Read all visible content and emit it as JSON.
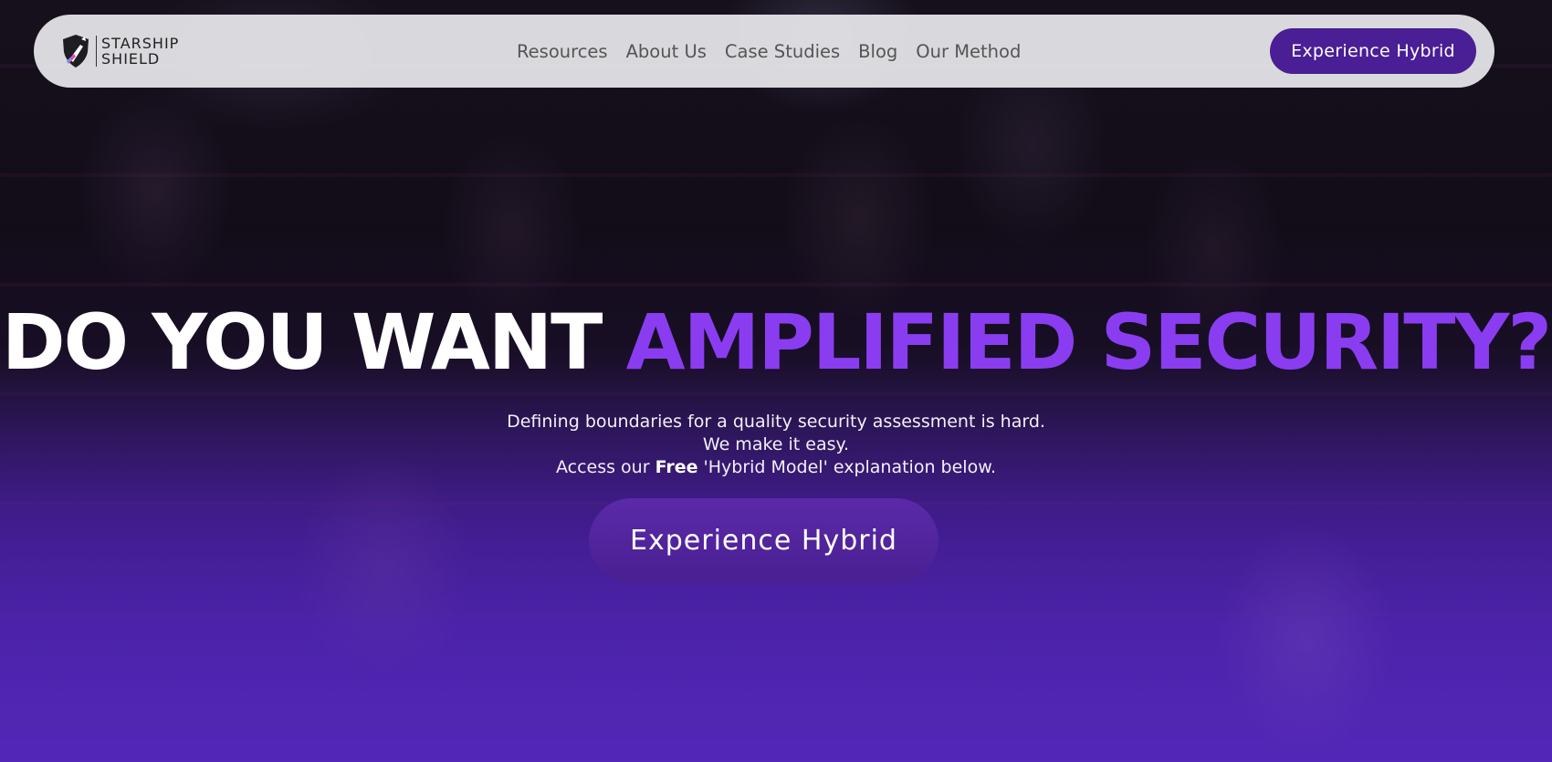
{
  "brand": {
    "line1": "STARSHIP",
    "line2": "SHIELD"
  },
  "nav": {
    "links": [
      "Resources",
      "About Us",
      "Case Studies",
      "Blog",
      "Our Method"
    ],
    "cta_label": "Experience Hybrid"
  },
  "hero": {
    "headline_part1": "DO YOU WANT",
    "headline_part2": "AMPLIFIED SECURITY?",
    "sub_line1": "Defining boundaries for a quality security assessment is hard.",
    "sub_line2": "We make it easy.",
    "sub_line3_before": "Access our ",
    "sub_line3_bold": "Free",
    "sub_line3_after": " 'Hybrid Model' explanation below.",
    "cta_label": "Experience Hybrid"
  },
  "colors": {
    "accent": "#8a3df0",
    "cta": "#4a1e94"
  },
  "icons": [
    "shield-icon",
    "rocket-icon"
  ]
}
